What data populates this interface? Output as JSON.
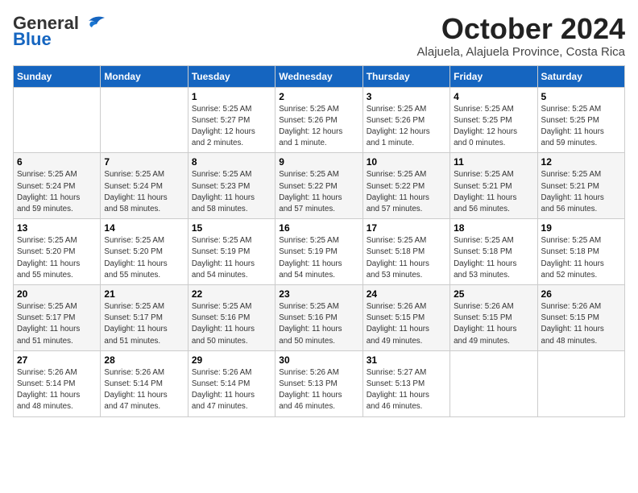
{
  "header": {
    "logo_line1": "General",
    "logo_line2": "Blue",
    "month": "October 2024",
    "location": "Alajuela, Alajuela Province, Costa Rica"
  },
  "days_of_week": [
    "Sunday",
    "Monday",
    "Tuesday",
    "Wednesday",
    "Thursday",
    "Friday",
    "Saturday"
  ],
  "weeks": [
    [
      {
        "day": "",
        "info": ""
      },
      {
        "day": "",
        "info": ""
      },
      {
        "day": "1",
        "info": "Sunrise: 5:25 AM\nSunset: 5:27 PM\nDaylight: 12 hours\nand 2 minutes."
      },
      {
        "day": "2",
        "info": "Sunrise: 5:25 AM\nSunset: 5:26 PM\nDaylight: 12 hours\nand 1 minute."
      },
      {
        "day": "3",
        "info": "Sunrise: 5:25 AM\nSunset: 5:26 PM\nDaylight: 12 hours\nand 1 minute."
      },
      {
        "day": "4",
        "info": "Sunrise: 5:25 AM\nSunset: 5:25 PM\nDaylight: 12 hours\nand 0 minutes."
      },
      {
        "day": "5",
        "info": "Sunrise: 5:25 AM\nSunset: 5:25 PM\nDaylight: 11 hours\nand 59 minutes."
      }
    ],
    [
      {
        "day": "6",
        "info": "Sunrise: 5:25 AM\nSunset: 5:24 PM\nDaylight: 11 hours\nand 59 minutes."
      },
      {
        "day": "7",
        "info": "Sunrise: 5:25 AM\nSunset: 5:24 PM\nDaylight: 11 hours\nand 58 minutes."
      },
      {
        "day": "8",
        "info": "Sunrise: 5:25 AM\nSunset: 5:23 PM\nDaylight: 11 hours\nand 58 minutes."
      },
      {
        "day": "9",
        "info": "Sunrise: 5:25 AM\nSunset: 5:22 PM\nDaylight: 11 hours\nand 57 minutes."
      },
      {
        "day": "10",
        "info": "Sunrise: 5:25 AM\nSunset: 5:22 PM\nDaylight: 11 hours\nand 57 minutes."
      },
      {
        "day": "11",
        "info": "Sunrise: 5:25 AM\nSunset: 5:21 PM\nDaylight: 11 hours\nand 56 minutes."
      },
      {
        "day": "12",
        "info": "Sunrise: 5:25 AM\nSunset: 5:21 PM\nDaylight: 11 hours\nand 56 minutes."
      }
    ],
    [
      {
        "day": "13",
        "info": "Sunrise: 5:25 AM\nSunset: 5:20 PM\nDaylight: 11 hours\nand 55 minutes."
      },
      {
        "day": "14",
        "info": "Sunrise: 5:25 AM\nSunset: 5:20 PM\nDaylight: 11 hours\nand 55 minutes."
      },
      {
        "day": "15",
        "info": "Sunrise: 5:25 AM\nSunset: 5:19 PM\nDaylight: 11 hours\nand 54 minutes."
      },
      {
        "day": "16",
        "info": "Sunrise: 5:25 AM\nSunset: 5:19 PM\nDaylight: 11 hours\nand 54 minutes."
      },
      {
        "day": "17",
        "info": "Sunrise: 5:25 AM\nSunset: 5:18 PM\nDaylight: 11 hours\nand 53 minutes."
      },
      {
        "day": "18",
        "info": "Sunrise: 5:25 AM\nSunset: 5:18 PM\nDaylight: 11 hours\nand 53 minutes."
      },
      {
        "day": "19",
        "info": "Sunrise: 5:25 AM\nSunset: 5:18 PM\nDaylight: 11 hours\nand 52 minutes."
      }
    ],
    [
      {
        "day": "20",
        "info": "Sunrise: 5:25 AM\nSunset: 5:17 PM\nDaylight: 11 hours\nand 51 minutes."
      },
      {
        "day": "21",
        "info": "Sunrise: 5:25 AM\nSunset: 5:17 PM\nDaylight: 11 hours\nand 51 minutes."
      },
      {
        "day": "22",
        "info": "Sunrise: 5:25 AM\nSunset: 5:16 PM\nDaylight: 11 hours\nand 50 minutes."
      },
      {
        "day": "23",
        "info": "Sunrise: 5:25 AM\nSunset: 5:16 PM\nDaylight: 11 hours\nand 50 minutes."
      },
      {
        "day": "24",
        "info": "Sunrise: 5:26 AM\nSunset: 5:15 PM\nDaylight: 11 hours\nand 49 minutes."
      },
      {
        "day": "25",
        "info": "Sunrise: 5:26 AM\nSunset: 5:15 PM\nDaylight: 11 hours\nand 49 minutes."
      },
      {
        "day": "26",
        "info": "Sunrise: 5:26 AM\nSunset: 5:15 PM\nDaylight: 11 hours\nand 48 minutes."
      }
    ],
    [
      {
        "day": "27",
        "info": "Sunrise: 5:26 AM\nSunset: 5:14 PM\nDaylight: 11 hours\nand 48 minutes."
      },
      {
        "day": "28",
        "info": "Sunrise: 5:26 AM\nSunset: 5:14 PM\nDaylight: 11 hours\nand 47 minutes."
      },
      {
        "day": "29",
        "info": "Sunrise: 5:26 AM\nSunset: 5:14 PM\nDaylight: 11 hours\nand 47 minutes."
      },
      {
        "day": "30",
        "info": "Sunrise: 5:26 AM\nSunset: 5:13 PM\nDaylight: 11 hours\nand 46 minutes."
      },
      {
        "day": "31",
        "info": "Sunrise: 5:27 AM\nSunset: 5:13 PM\nDaylight: 11 hours\nand 46 minutes."
      },
      {
        "day": "",
        "info": ""
      },
      {
        "day": "",
        "info": ""
      }
    ]
  ]
}
